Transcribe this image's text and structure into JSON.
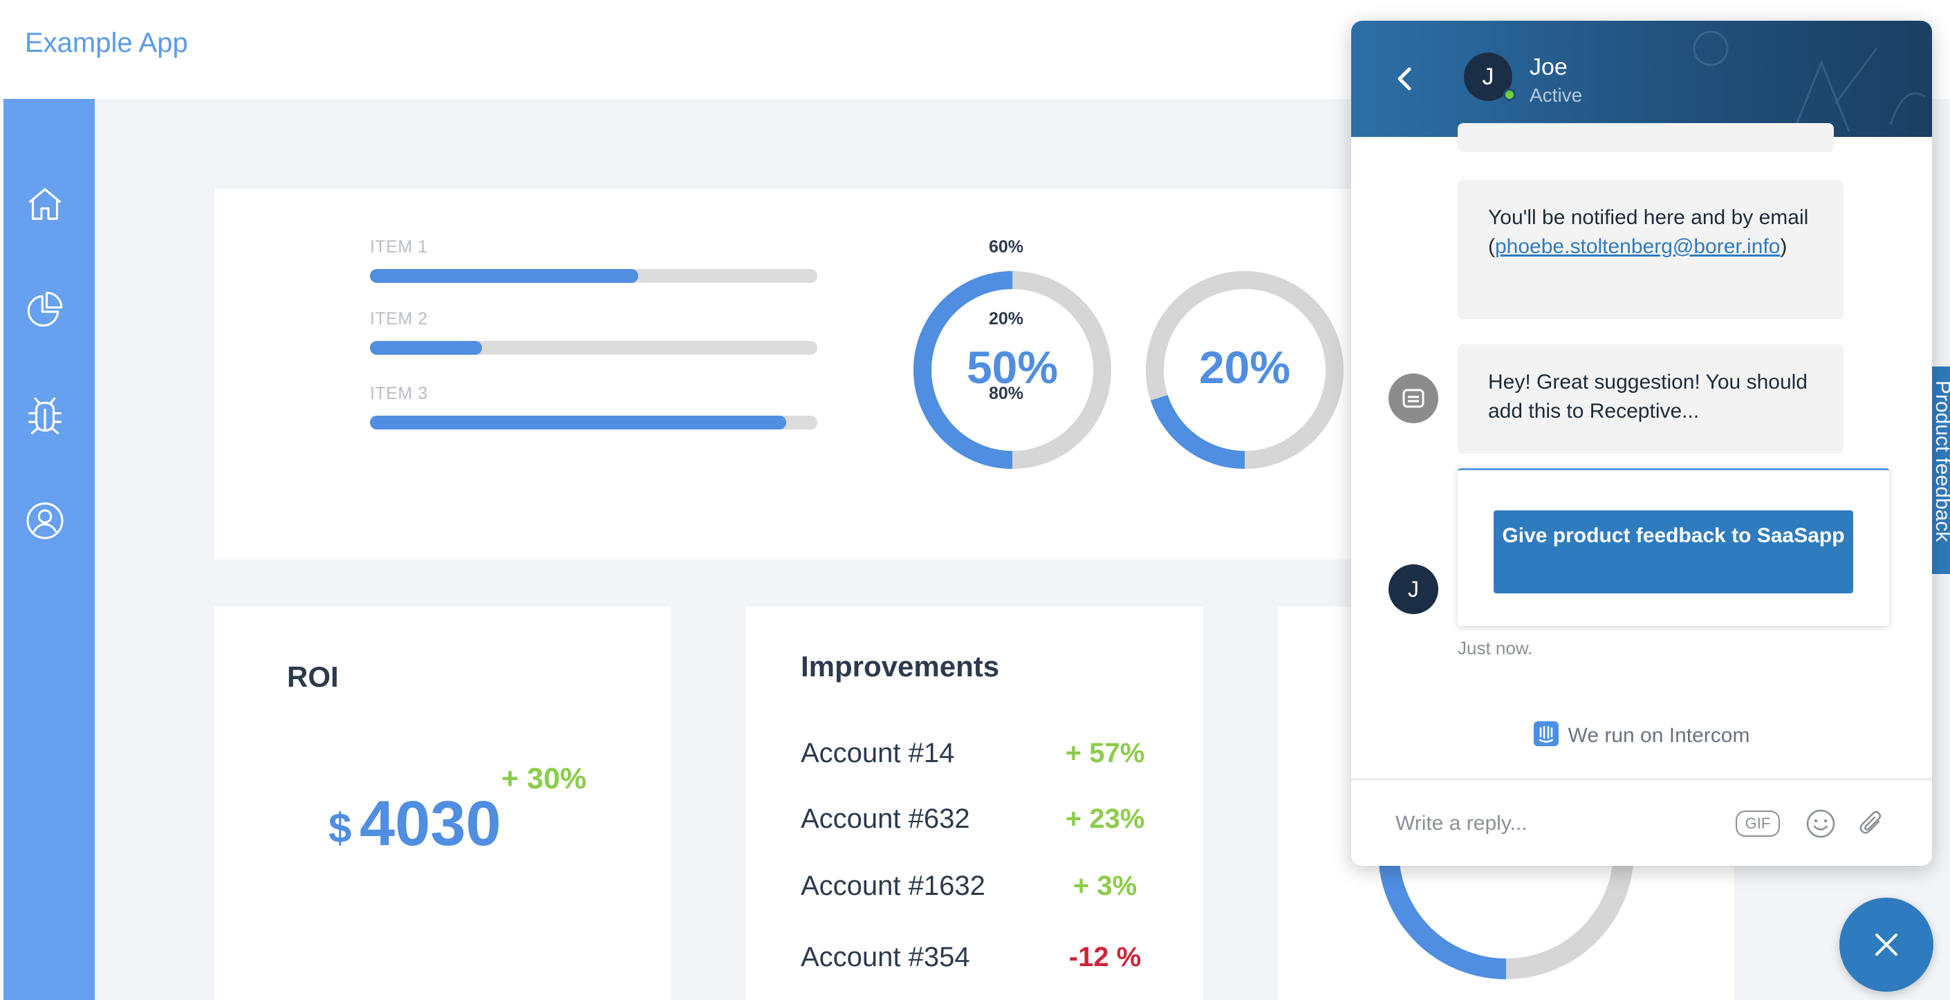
{
  "app": {
    "title": "Example App"
  },
  "sidebar": {
    "items": [
      {
        "icon": "home-icon"
      },
      {
        "icon": "pie-chart-icon"
      },
      {
        "icon": "bug-icon"
      },
      {
        "icon": "user-circle-icon"
      }
    ]
  },
  "progress_items": [
    {
      "label": "ITEM 1",
      "value_label": "60%",
      "value": 0.6
    },
    {
      "label": "ITEM 2",
      "value_label": "20%",
      "value": 0.25
    },
    {
      "label": "ITEM 3",
      "value_label": "80%",
      "value": 0.93
    }
  ],
  "donuts": [
    {
      "label": "50%",
      "value": 0.5
    },
    {
      "label": "20%",
      "value": 0.2
    }
  ],
  "roi": {
    "title": "ROI",
    "currency": "$",
    "value": "4030",
    "delta": "+ 30%"
  },
  "improvements": {
    "title": "Improvements",
    "rows": [
      {
        "account": "Account #14",
        "change": "+ 57%",
        "trend": "pos"
      },
      {
        "account": "Account #632",
        "change": "+ 23%",
        "trend": "pos"
      },
      {
        "account": "Account #1632",
        "change": "+ 3%",
        "trend": "pos"
      },
      {
        "account": "Account #354",
        "change": "-12 %",
        "trend": "neg"
      }
    ]
  },
  "feedback_tab": {
    "label": "Product feedback"
  },
  "chat": {
    "agent_name": "Joe",
    "agent_initial": "J",
    "agent_status": "Active",
    "message_1_prefix": "You'll be notified here and by email (",
    "message_1_email": "phoebe.stoltenberg@borer.info",
    "message_1_suffix": ")",
    "message_2": "Hey! Great suggestion! You should add this to Receptive...",
    "feedback_button": "Give product feedback to SaaSapp",
    "timestamp": "Just now.",
    "powered_by": "We run on Intercom",
    "reply_placeholder": "Write a reply...",
    "gif_label": "GIF"
  },
  "colors": {
    "accent": "#4f8ee0",
    "sidebar": "#66a0ee",
    "positive": "#8ccc4a",
    "negative": "#d0243a",
    "chat_header": "#214f7a",
    "chat_button": "#2f7bbf"
  }
}
